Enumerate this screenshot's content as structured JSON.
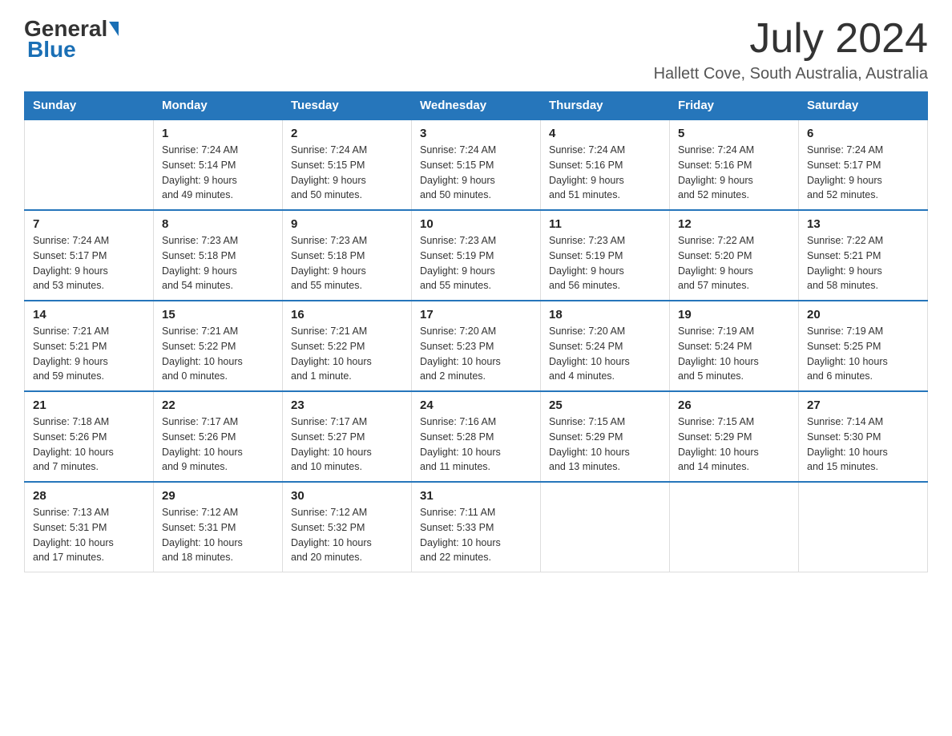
{
  "header": {
    "logo_general": "General",
    "logo_blue": "Blue",
    "month_title": "July 2024",
    "location": "Hallett Cove, South Australia, Australia"
  },
  "weekdays": [
    "Sunday",
    "Monday",
    "Tuesday",
    "Wednesday",
    "Thursday",
    "Friday",
    "Saturday"
  ],
  "weeks": [
    [
      {
        "day": "",
        "info": ""
      },
      {
        "day": "1",
        "info": "Sunrise: 7:24 AM\nSunset: 5:14 PM\nDaylight: 9 hours\nand 49 minutes."
      },
      {
        "day": "2",
        "info": "Sunrise: 7:24 AM\nSunset: 5:15 PM\nDaylight: 9 hours\nand 50 minutes."
      },
      {
        "day": "3",
        "info": "Sunrise: 7:24 AM\nSunset: 5:15 PM\nDaylight: 9 hours\nand 50 minutes."
      },
      {
        "day": "4",
        "info": "Sunrise: 7:24 AM\nSunset: 5:16 PM\nDaylight: 9 hours\nand 51 minutes."
      },
      {
        "day": "5",
        "info": "Sunrise: 7:24 AM\nSunset: 5:16 PM\nDaylight: 9 hours\nand 52 minutes."
      },
      {
        "day": "6",
        "info": "Sunrise: 7:24 AM\nSunset: 5:17 PM\nDaylight: 9 hours\nand 52 minutes."
      }
    ],
    [
      {
        "day": "7",
        "info": "Sunrise: 7:24 AM\nSunset: 5:17 PM\nDaylight: 9 hours\nand 53 minutes."
      },
      {
        "day": "8",
        "info": "Sunrise: 7:23 AM\nSunset: 5:18 PM\nDaylight: 9 hours\nand 54 minutes."
      },
      {
        "day": "9",
        "info": "Sunrise: 7:23 AM\nSunset: 5:18 PM\nDaylight: 9 hours\nand 55 minutes."
      },
      {
        "day": "10",
        "info": "Sunrise: 7:23 AM\nSunset: 5:19 PM\nDaylight: 9 hours\nand 55 minutes."
      },
      {
        "day": "11",
        "info": "Sunrise: 7:23 AM\nSunset: 5:19 PM\nDaylight: 9 hours\nand 56 minutes."
      },
      {
        "day": "12",
        "info": "Sunrise: 7:22 AM\nSunset: 5:20 PM\nDaylight: 9 hours\nand 57 minutes."
      },
      {
        "day": "13",
        "info": "Sunrise: 7:22 AM\nSunset: 5:21 PM\nDaylight: 9 hours\nand 58 minutes."
      }
    ],
    [
      {
        "day": "14",
        "info": "Sunrise: 7:21 AM\nSunset: 5:21 PM\nDaylight: 9 hours\nand 59 minutes."
      },
      {
        "day": "15",
        "info": "Sunrise: 7:21 AM\nSunset: 5:22 PM\nDaylight: 10 hours\nand 0 minutes."
      },
      {
        "day": "16",
        "info": "Sunrise: 7:21 AM\nSunset: 5:22 PM\nDaylight: 10 hours\nand 1 minute."
      },
      {
        "day": "17",
        "info": "Sunrise: 7:20 AM\nSunset: 5:23 PM\nDaylight: 10 hours\nand 2 minutes."
      },
      {
        "day": "18",
        "info": "Sunrise: 7:20 AM\nSunset: 5:24 PM\nDaylight: 10 hours\nand 4 minutes."
      },
      {
        "day": "19",
        "info": "Sunrise: 7:19 AM\nSunset: 5:24 PM\nDaylight: 10 hours\nand 5 minutes."
      },
      {
        "day": "20",
        "info": "Sunrise: 7:19 AM\nSunset: 5:25 PM\nDaylight: 10 hours\nand 6 minutes."
      }
    ],
    [
      {
        "day": "21",
        "info": "Sunrise: 7:18 AM\nSunset: 5:26 PM\nDaylight: 10 hours\nand 7 minutes."
      },
      {
        "day": "22",
        "info": "Sunrise: 7:17 AM\nSunset: 5:26 PM\nDaylight: 10 hours\nand 9 minutes."
      },
      {
        "day": "23",
        "info": "Sunrise: 7:17 AM\nSunset: 5:27 PM\nDaylight: 10 hours\nand 10 minutes."
      },
      {
        "day": "24",
        "info": "Sunrise: 7:16 AM\nSunset: 5:28 PM\nDaylight: 10 hours\nand 11 minutes."
      },
      {
        "day": "25",
        "info": "Sunrise: 7:15 AM\nSunset: 5:29 PM\nDaylight: 10 hours\nand 13 minutes."
      },
      {
        "day": "26",
        "info": "Sunrise: 7:15 AM\nSunset: 5:29 PM\nDaylight: 10 hours\nand 14 minutes."
      },
      {
        "day": "27",
        "info": "Sunrise: 7:14 AM\nSunset: 5:30 PM\nDaylight: 10 hours\nand 15 minutes."
      }
    ],
    [
      {
        "day": "28",
        "info": "Sunrise: 7:13 AM\nSunset: 5:31 PM\nDaylight: 10 hours\nand 17 minutes."
      },
      {
        "day": "29",
        "info": "Sunrise: 7:12 AM\nSunset: 5:31 PM\nDaylight: 10 hours\nand 18 minutes."
      },
      {
        "day": "30",
        "info": "Sunrise: 7:12 AM\nSunset: 5:32 PM\nDaylight: 10 hours\nand 20 minutes."
      },
      {
        "day": "31",
        "info": "Sunrise: 7:11 AM\nSunset: 5:33 PM\nDaylight: 10 hours\nand 22 minutes."
      },
      {
        "day": "",
        "info": ""
      },
      {
        "day": "",
        "info": ""
      },
      {
        "day": "",
        "info": ""
      }
    ]
  ]
}
